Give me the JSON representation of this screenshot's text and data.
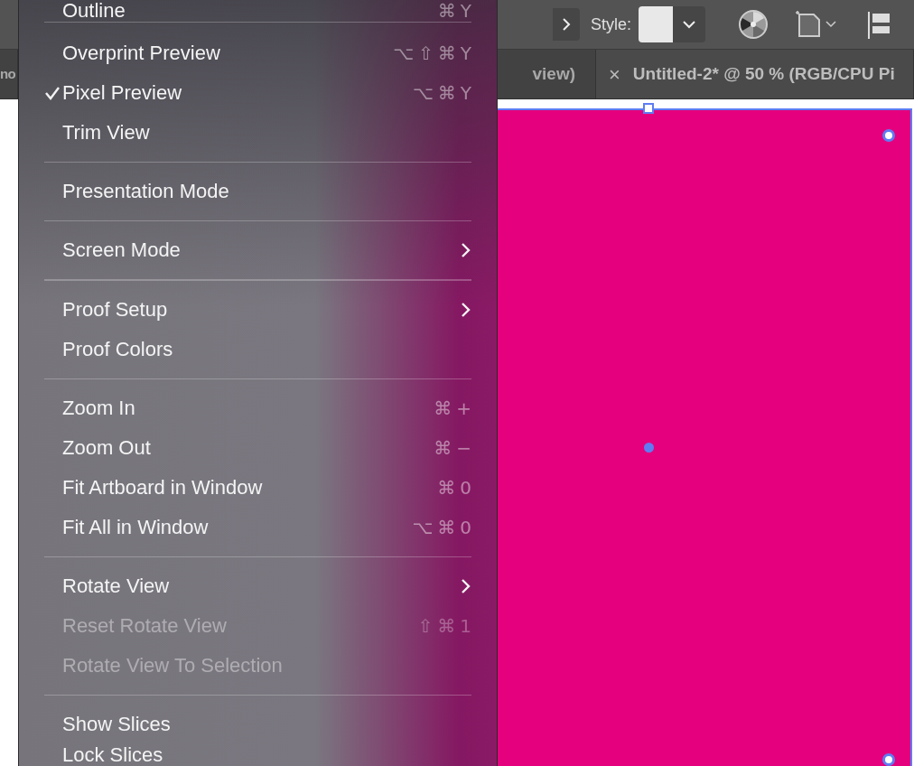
{
  "toolbar": {
    "style_label": "Style:"
  },
  "tabs": [
    {
      "label": "no",
      "selected": false
    },
    {
      "label": "view)",
      "selected": false
    },
    {
      "label": "Untitled-2* @ 50 % (RGB/CPU Pi",
      "selected": true,
      "closable": true,
      "close": "×"
    }
  ],
  "menu": {
    "groups": [
      [
        {
          "label": "Outline",
          "shortcut": "⌘Y",
          "checked": false,
          "disabled": false,
          "submenu": false
        }
      ],
      [
        {
          "label": "Overprint Preview",
          "shortcut": "⌥⇧⌘Y",
          "checked": false,
          "disabled": false,
          "submenu": false
        },
        {
          "label": "Pixel Preview",
          "shortcut": "⌥⌘Y",
          "checked": true,
          "disabled": false,
          "submenu": false
        },
        {
          "label": "Trim View",
          "checked": false,
          "disabled": false,
          "submenu": false
        }
      ],
      [
        {
          "label": "Presentation Mode",
          "checked": false,
          "disabled": false,
          "submenu": false
        }
      ],
      [
        {
          "label": "Screen Mode",
          "checked": false,
          "disabled": false,
          "submenu": true
        }
      ],
      [
        {
          "label": "Proof Setup",
          "checked": false,
          "disabled": false,
          "submenu": true
        },
        {
          "label": "Proof Colors",
          "checked": false,
          "disabled": false,
          "submenu": false
        }
      ],
      [
        {
          "label": "Zoom In",
          "shortcut": "⌘+",
          "checked": false,
          "disabled": false,
          "submenu": false
        },
        {
          "label": "Zoom Out",
          "shortcut": "⌘−",
          "checked": false,
          "disabled": false,
          "submenu": false
        },
        {
          "label": "Fit Artboard in Window",
          "shortcut": "⌘0",
          "checked": false,
          "disabled": false,
          "submenu": false
        },
        {
          "label": "Fit All in Window",
          "shortcut": "⌥⌘0",
          "checked": false,
          "disabled": false,
          "submenu": false
        }
      ],
      [
        {
          "label": "Rotate View",
          "checked": false,
          "disabled": false,
          "submenu": true
        },
        {
          "label": "Reset Rotate View",
          "shortcut": "⇧⌘1",
          "checked": false,
          "disabled": true,
          "submenu": false
        },
        {
          "label": "Rotate View To Selection",
          "checked": false,
          "disabled": true,
          "submenu": false
        }
      ],
      [
        {
          "label": "Show Slices",
          "checked": false,
          "disabled": false,
          "submenu": false
        },
        {
          "label": "Lock Slices",
          "checked": false,
          "disabled": false,
          "submenu": false
        }
      ]
    ]
  }
}
